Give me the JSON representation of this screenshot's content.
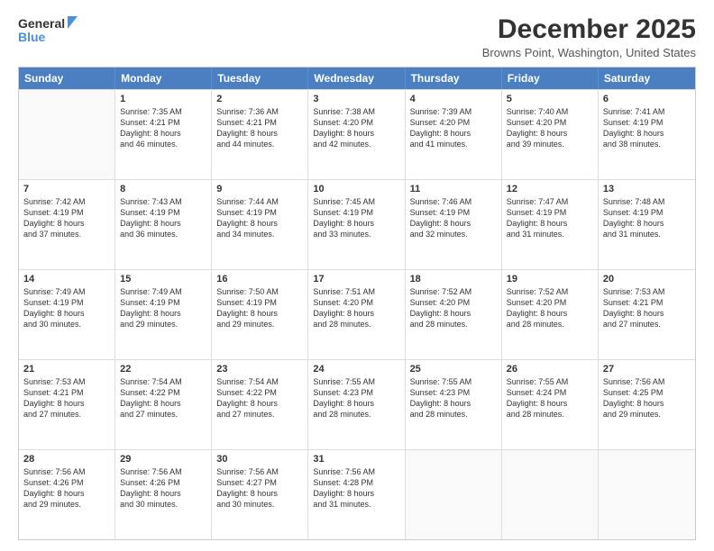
{
  "header": {
    "logo_line1": "General",
    "logo_line2": "Blue",
    "month": "December 2025",
    "location": "Browns Point, Washington, United States"
  },
  "days_of_week": [
    "Sunday",
    "Monday",
    "Tuesday",
    "Wednesday",
    "Thursday",
    "Friday",
    "Saturday"
  ],
  "rows": [
    [
      {
        "day": "",
        "empty": true
      },
      {
        "day": "1",
        "sunrise": "Sunrise: 7:35 AM",
        "sunset": "Sunset: 4:21 PM",
        "daylight": "Daylight: 8 hours",
        "daylight2": "and 46 minutes."
      },
      {
        "day": "2",
        "sunrise": "Sunrise: 7:36 AM",
        "sunset": "Sunset: 4:21 PM",
        "daylight": "Daylight: 8 hours",
        "daylight2": "and 44 minutes."
      },
      {
        "day": "3",
        "sunrise": "Sunrise: 7:38 AM",
        "sunset": "Sunset: 4:20 PM",
        "daylight": "Daylight: 8 hours",
        "daylight2": "and 42 minutes."
      },
      {
        "day": "4",
        "sunrise": "Sunrise: 7:39 AM",
        "sunset": "Sunset: 4:20 PM",
        "daylight": "Daylight: 8 hours",
        "daylight2": "and 41 minutes."
      },
      {
        "day": "5",
        "sunrise": "Sunrise: 7:40 AM",
        "sunset": "Sunset: 4:20 PM",
        "daylight": "Daylight: 8 hours",
        "daylight2": "and 39 minutes."
      },
      {
        "day": "6",
        "sunrise": "Sunrise: 7:41 AM",
        "sunset": "Sunset: 4:19 PM",
        "daylight": "Daylight: 8 hours",
        "daylight2": "and 38 minutes."
      }
    ],
    [
      {
        "day": "7",
        "sunrise": "Sunrise: 7:42 AM",
        "sunset": "Sunset: 4:19 PM",
        "daylight": "Daylight: 8 hours",
        "daylight2": "and 37 minutes."
      },
      {
        "day": "8",
        "sunrise": "Sunrise: 7:43 AM",
        "sunset": "Sunset: 4:19 PM",
        "daylight": "Daylight: 8 hours",
        "daylight2": "and 36 minutes."
      },
      {
        "day": "9",
        "sunrise": "Sunrise: 7:44 AM",
        "sunset": "Sunset: 4:19 PM",
        "daylight": "Daylight: 8 hours",
        "daylight2": "and 34 minutes."
      },
      {
        "day": "10",
        "sunrise": "Sunrise: 7:45 AM",
        "sunset": "Sunset: 4:19 PM",
        "daylight": "Daylight: 8 hours",
        "daylight2": "and 33 minutes."
      },
      {
        "day": "11",
        "sunrise": "Sunrise: 7:46 AM",
        "sunset": "Sunset: 4:19 PM",
        "daylight": "Daylight: 8 hours",
        "daylight2": "and 32 minutes."
      },
      {
        "day": "12",
        "sunrise": "Sunrise: 7:47 AM",
        "sunset": "Sunset: 4:19 PM",
        "daylight": "Daylight: 8 hours",
        "daylight2": "and 31 minutes."
      },
      {
        "day": "13",
        "sunrise": "Sunrise: 7:48 AM",
        "sunset": "Sunset: 4:19 PM",
        "daylight": "Daylight: 8 hours",
        "daylight2": "and 31 minutes."
      }
    ],
    [
      {
        "day": "14",
        "sunrise": "Sunrise: 7:49 AM",
        "sunset": "Sunset: 4:19 PM",
        "daylight": "Daylight: 8 hours",
        "daylight2": "and 30 minutes."
      },
      {
        "day": "15",
        "sunrise": "Sunrise: 7:49 AM",
        "sunset": "Sunset: 4:19 PM",
        "daylight": "Daylight: 8 hours",
        "daylight2": "and 29 minutes."
      },
      {
        "day": "16",
        "sunrise": "Sunrise: 7:50 AM",
        "sunset": "Sunset: 4:19 PM",
        "daylight": "Daylight: 8 hours",
        "daylight2": "and 29 minutes."
      },
      {
        "day": "17",
        "sunrise": "Sunrise: 7:51 AM",
        "sunset": "Sunset: 4:20 PM",
        "daylight": "Daylight: 8 hours",
        "daylight2": "and 28 minutes."
      },
      {
        "day": "18",
        "sunrise": "Sunrise: 7:52 AM",
        "sunset": "Sunset: 4:20 PM",
        "daylight": "Daylight: 8 hours",
        "daylight2": "and 28 minutes."
      },
      {
        "day": "19",
        "sunrise": "Sunrise: 7:52 AM",
        "sunset": "Sunset: 4:20 PM",
        "daylight": "Daylight: 8 hours",
        "daylight2": "and 28 minutes."
      },
      {
        "day": "20",
        "sunrise": "Sunrise: 7:53 AM",
        "sunset": "Sunset: 4:21 PM",
        "daylight": "Daylight: 8 hours",
        "daylight2": "and 27 minutes."
      }
    ],
    [
      {
        "day": "21",
        "sunrise": "Sunrise: 7:53 AM",
        "sunset": "Sunset: 4:21 PM",
        "daylight": "Daylight: 8 hours",
        "daylight2": "and 27 minutes."
      },
      {
        "day": "22",
        "sunrise": "Sunrise: 7:54 AM",
        "sunset": "Sunset: 4:22 PM",
        "daylight": "Daylight: 8 hours",
        "daylight2": "and 27 minutes."
      },
      {
        "day": "23",
        "sunrise": "Sunrise: 7:54 AM",
        "sunset": "Sunset: 4:22 PM",
        "daylight": "Daylight: 8 hours",
        "daylight2": "and 27 minutes."
      },
      {
        "day": "24",
        "sunrise": "Sunrise: 7:55 AM",
        "sunset": "Sunset: 4:23 PM",
        "daylight": "Daylight: 8 hours",
        "daylight2": "and 28 minutes."
      },
      {
        "day": "25",
        "sunrise": "Sunrise: 7:55 AM",
        "sunset": "Sunset: 4:23 PM",
        "daylight": "Daylight: 8 hours",
        "daylight2": "and 28 minutes."
      },
      {
        "day": "26",
        "sunrise": "Sunrise: 7:55 AM",
        "sunset": "Sunset: 4:24 PM",
        "daylight": "Daylight: 8 hours",
        "daylight2": "and 28 minutes."
      },
      {
        "day": "27",
        "sunrise": "Sunrise: 7:56 AM",
        "sunset": "Sunset: 4:25 PM",
        "daylight": "Daylight: 8 hours",
        "daylight2": "and 29 minutes."
      }
    ],
    [
      {
        "day": "28",
        "sunrise": "Sunrise: 7:56 AM",
        "sunset": "Sunset: 4:26 PM",
        "daylight": "Daylight: 8 hours",
        "daylight2": "and 29 minutes."
      },
      {
        "day": "29",
        "sunrise": "Sunrise: 7:56 AM",
        "sunset": "Sunset: 4:26 PM",
        "daylight": "Daylight: 8 hours",
        "daylight2": "and 30 minutes."
      },
      {
        "day": "30",
        "sunrise": "Sunrise: 7:56 AM",
        "sunset": "Sunset: 4:27 PM",
        "daylight": "Daylight: 8 hours",
        "daylight2": "and 30 minutes."
      },
      {
        "day": "31",
        "sunrise": "Sunrise: 7:56 AM",
        "sunset": "Sunset: 4:28 PM",
        "daylight": "Daylight: 8 hours",
        "daylight2": "and 31 minutes."
      },
      {
        "day": "",
        "empty": true
      },
      {
        "day": "",
        "empty": true
      },
      {
        "day": "",
        "empty": true
      }
    ]
  ]
}
